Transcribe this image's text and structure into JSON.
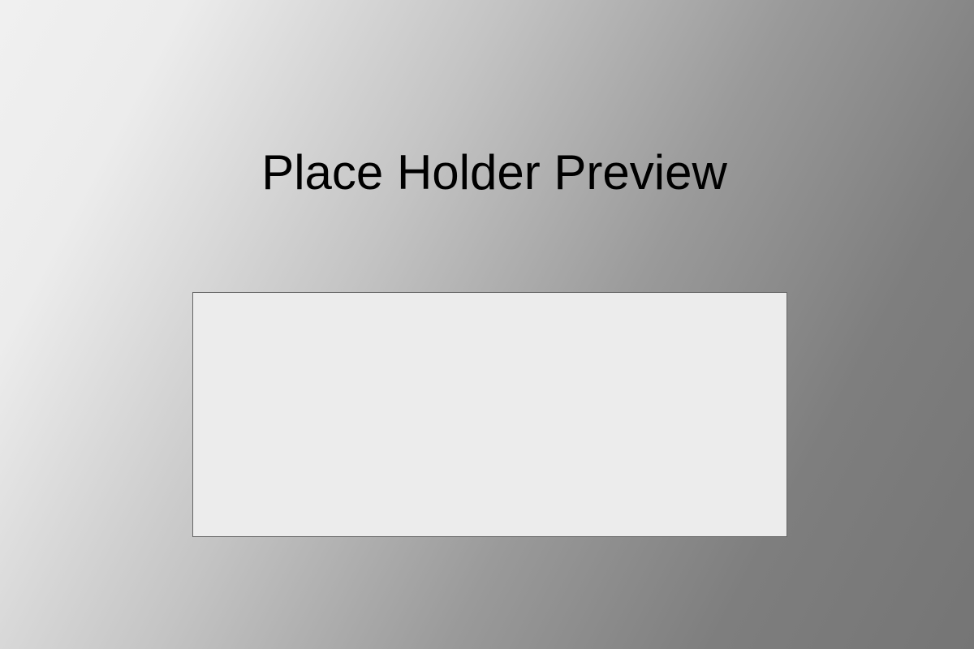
{
  "title": "Place Holder Preview",
  "colors": {
    "box_fill": "#ececec",
    "box_border": "#666666",
    "gradient_light": "#eeeeee",
    "gradient_dark": "#757575"
  }
}
